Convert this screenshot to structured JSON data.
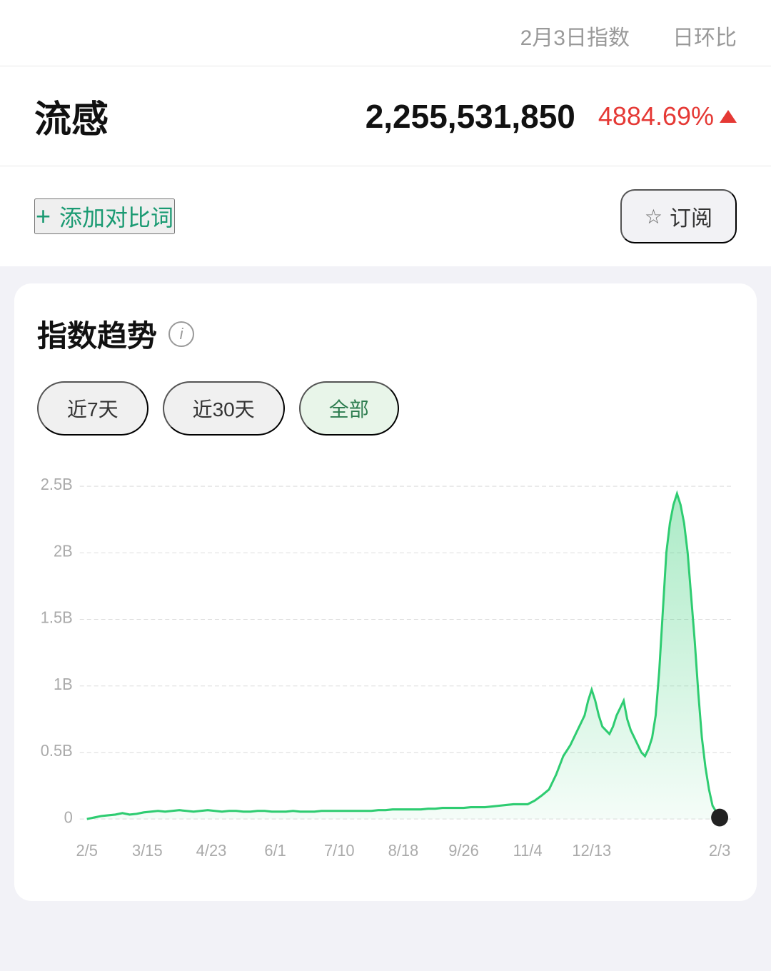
{
  "header": {
    "date_label": "2月3日指数",
    "compare_label": "日环比"
  },
  "keyword": {
    "name": "流感",
    "value": "2,255,531,850",
    "change": "4884.69%",
    "trend": "up"
  },
  "actions": {
    "add_compare": "添加对比词",
    "subscribe": "订阅"
  },
  "chart": {
    "title": "指数趋势",
    "info_icon": "i",
    "tabs": [
      {
        "label": "近7天",
        "active": false
      },
      {
        "label": "近30天",
        "active": false
      },
      {
        "label": "全部",
        "active": true
      }
    ],
    "y_labels": [
      "2.5B",
      "2B",
      "1.5B",
      "1B",
      "0.5B",
      "0"
    ],
    "x_labels": [
      "2/5",
      "3/15",
      "4/23",
      "6/1",
      "7/10",
      "8/18",
      "9/26",
      "11/4",
      "12/13",
      "2/3"
    ],
    "colors": {
      "line": "#2ecc71",
      "fill": "#2ecc71",
      "dot": "#222"
    }
  }
}
